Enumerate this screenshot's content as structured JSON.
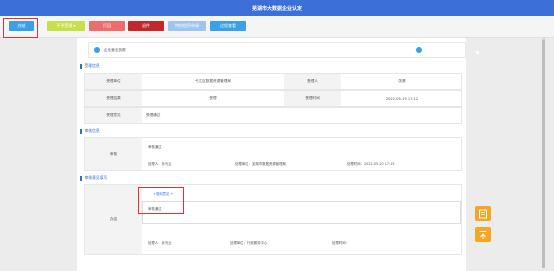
{
  "header": {
    "title": "芜湖市大数据企业认定"
  },
  "toolbar": {
    "buttons": [
      {
        "label": "办结",
        "color": "#3aa0e8"
      },
      {
        "label": "不予受理 ▾",
        "color": "#c6e04c"
      },
      {
        "label": "打回",
        "color": "#ec6d6d"
      },
      {
        "label": "退件",
        "color": "#c0282d"
      },
      {
        "label": "特别程序申请",
        "color": "#9ec5ee"
      },
      {
        "label": "过程查看",
        "color": "#3aa0e8"
      }
    ]
  },
  "info_bar": {
    "label": "企业营业执照"
  },
  "accept_section": {
    "title": "受理信息",
    "unit_label": "受理单位",
    "unit_value": "弋江区数据资源管理局",
    "person_label": "受理人",
    "person_value": "张婆",
    "result_label": "受理结果",
    "result_value": "受理",
    "time_label": "受理时间",
    "time_value": "2022-05-19 17:12",
    "opinion_label": "受理意见",
    "opinion_value": "受理通过"
  },
  "review_section": {
    "title": "审核信息",
    "row_label": "审核",
    "status": "审核通过",
    "handler": "处理人：孙光云",
    "unit": "处理单位：芜湖市数据资源管理局",
    "time": "处理时间：2022-05-20 17:15"
  },
  "opinion_section": {
    "title": "审核意见填写",
    "row_label": "办结",
    "common_opinions": "+常用意见 +",
    "textarea_value": "审核通过",
    "handler": "处理人：孙光云",
    "unit": "处理单位：行政服务中心",
    "time": "处理时间："
  },
  "float_buttons": [
    {
      "icon": "edit-doc-icon"
    },
    {
      "icon": "top-arrow-icon"
    }
  ],
  "colors": {
    "header": "#3d6fd9",
    "accent": "#3aa0e8",
    "highlight": "#e0303a"
  }
}
